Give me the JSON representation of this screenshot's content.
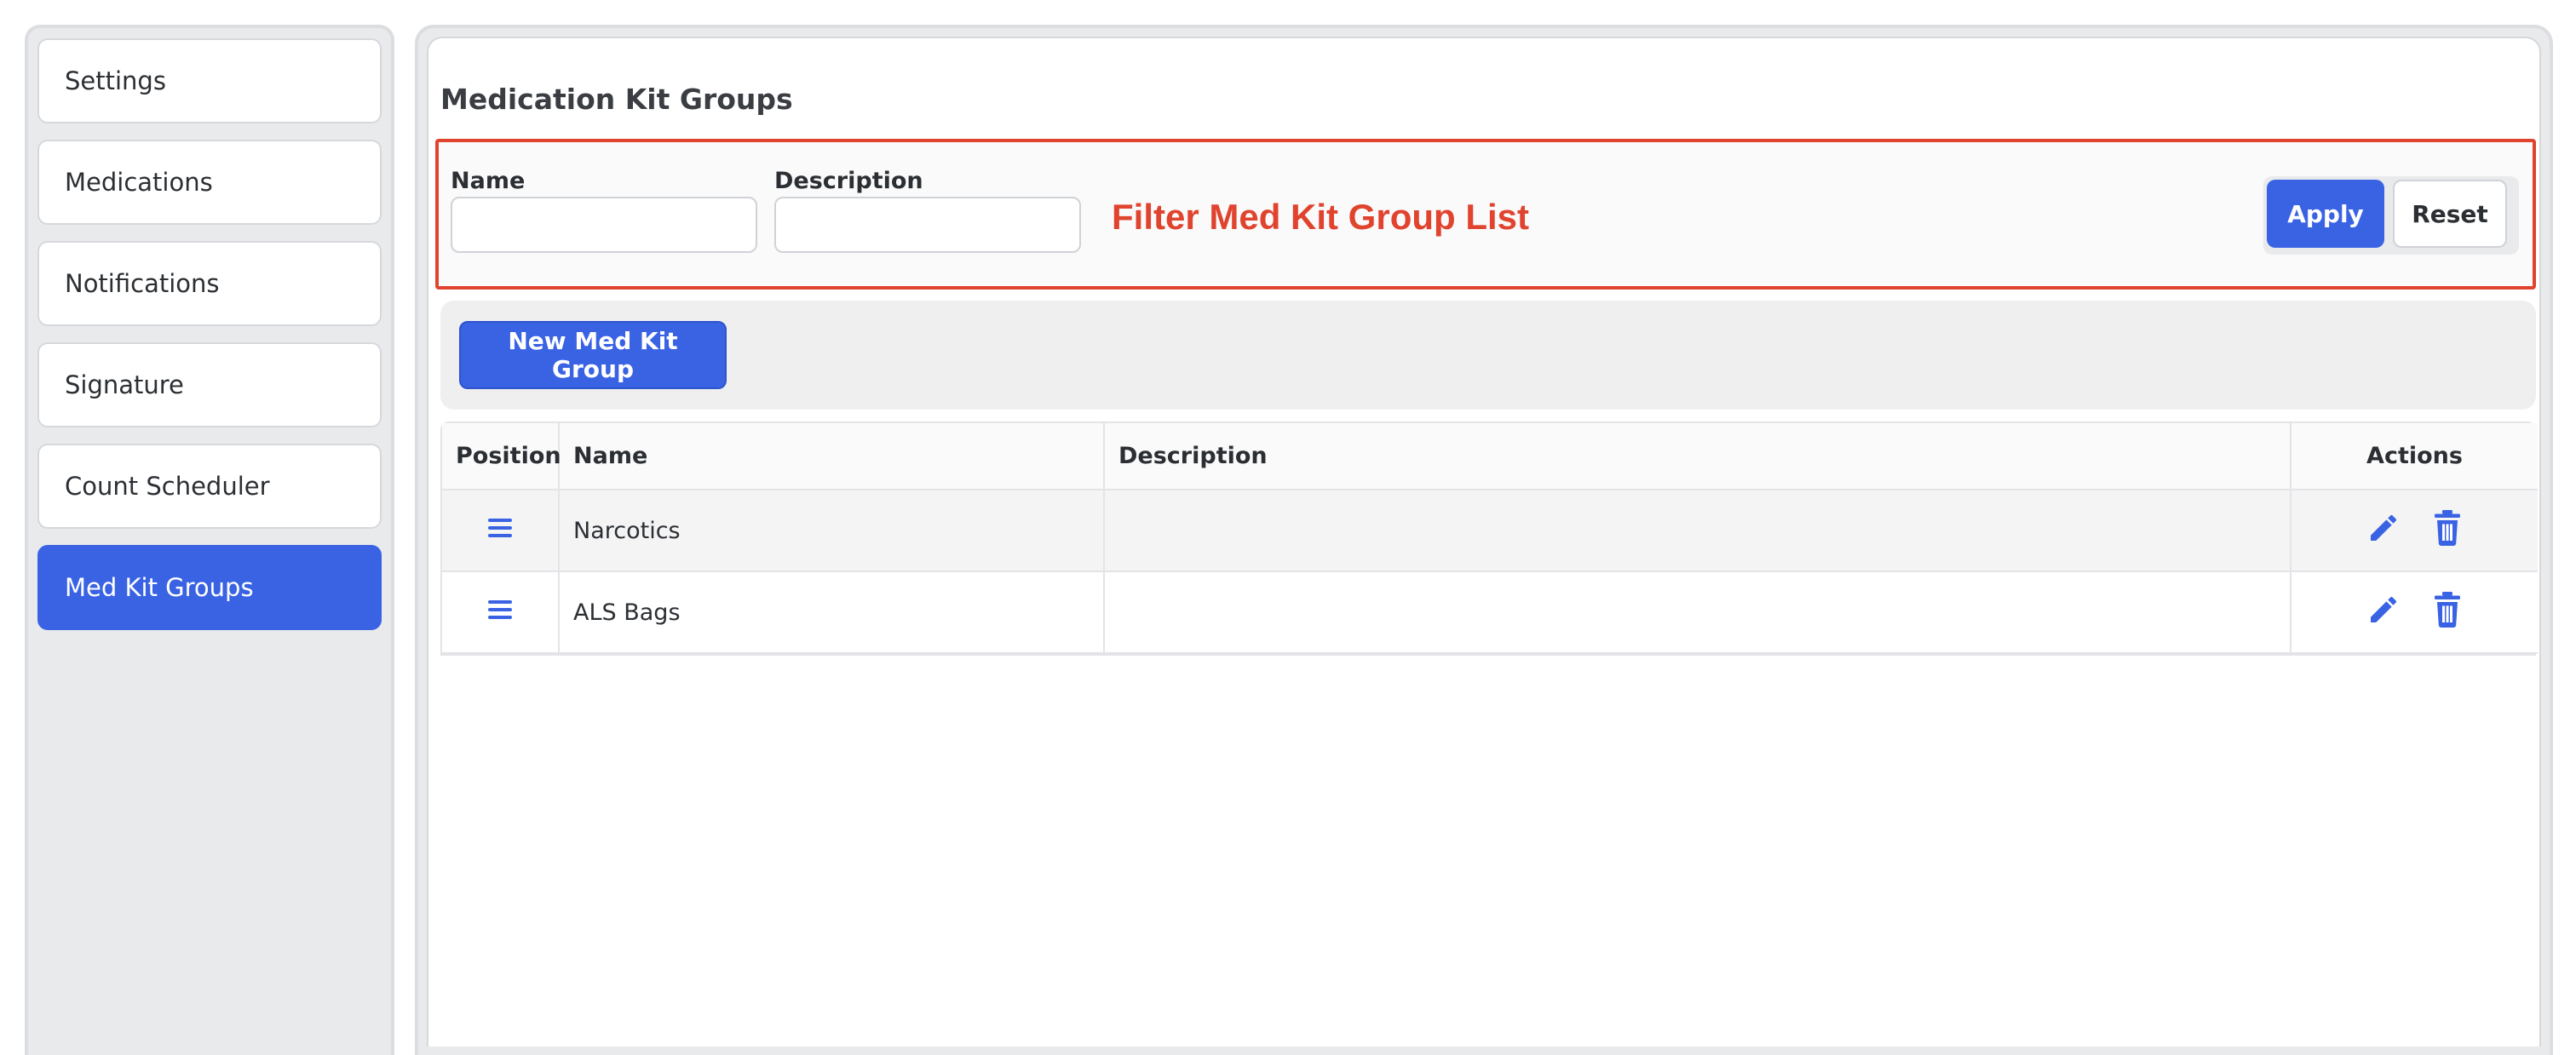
{
  "sidebar": {
    "items": [
      {
        "label": "Settings",
        "active": false
      },
      {
        "label": "Medications",
        "active": false
      },
      {
        "label": "Notifications",
        "active": false
      },
      {
        "label": "Signature",
        "active": false
      },
      {
        "label": "Count Scheduler",
        "active": false
      },
      {
        "label": "Med Kit Groups",
        "active": true
      }
    ]
  },
  "main": {
    "title": "Medication Kit Groups",
    "filter": {
      "name_label": "Name",
      "name_value": "",
      "description_label": "Description",
      "description_value": "",
      "annotation": "Filter Med Kit Group List",
      "apply_label": "Apply",
      "reset_label": "Reset"
    },
    "toolbar": {
      "new_button_label": "New Med Kit Group"
    },
    "table": {
      "headers": {
        "position": "Position",
        "name": "Name",
        "description": "Description",
        "actions": "Actions"
      },
      "rows": [
        {
          "name": "Narcotics",
          "description": ""
        },
        {
          "name": "ALS Bags",
          "description": ""
        }
      ]
    }
  },
  "colors": {
    "accent": "#3a63e4",
    "annotation": "#e0432e"
  },
  "icons": {
    "drag": "drag-handle-icon",
    "edit": "pencil-icon",
    "delete": "trash-icon"
  }
}
